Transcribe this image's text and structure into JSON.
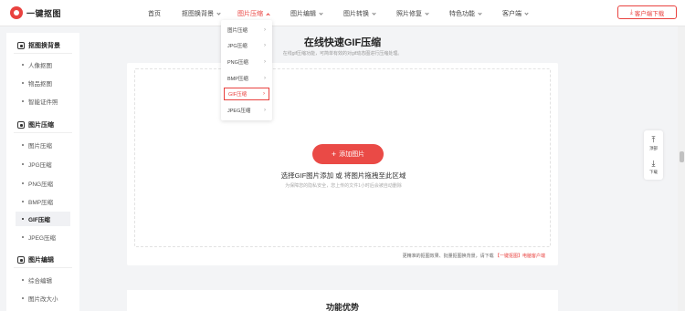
{
  "app": {
    "logo_text": "一键抠图"
  },
  "nav": {
    "items": [
      {
        "label": "首页"
      },
      {
        "label": "抠图换背景"
      },
      {
        "label": "图片压缩"
      },
      {
        "label": "图片编辑"
      },
      {
        "label": "图片转换"
      },
      {
        "label": "照片修复"
      },
      {
        "label": "特色功能"
      },
      {
        "label": "客户端"
      }
    ],
    "download_label": "客户端下载",
    "active_color": "#e9423f"
  },
  "dropdown": {
    "items": [
      {
        "label": "图片压缩"
      },
      {
        "label": "JPG压缩"
      },
      {
        "label": "PNG压缩"
      },
      {
        "label": "BMP压缩"
      },
      {
        "label": "GIF压缩"
      },
      {
        "label": "JPEG压缩"
      }
    ],
    "arrow": "›",
    "active_index": 4
  },
  "sidebar": {
    "sections": [
      {
        "title": "抠图换背景",
        "items": [
          "人像抠图",
          "物品抠图",
          "智能证件照"
        ]
      },
      {
        "title": "图片压缩",
        "items": [
          "图片压缩",
          "JPG压缩",
          "PNG压缩",
          "BMP压缩",
          "GIF压缩",
          "JPEG压缩"
        ]
      },
      {
        "title": "图片编辑",
        "items": [
          "综合编辑",
          "图片改大小"
        ]
      }
    ],
    "active_item": "GIF压缩"
  },
  "main": {
    "title": "在线快速GIF压缩",
    "subtitle": "在线gif压缩功能，可简单有效的对gif动态图进行压缩处理。",
    "add_button": "添加图片",
    "drop_text": "选择GIF图片添加 或 将图片拖拽至此区域",
    "privacy_text": "为保障您的隐私安全，您上传的文件1小时后会被自动删除",
    "footer_hint_prefix": "更精准的抠图效果、批量抠图换背景，请下载",
    "footer_hint_link": "【一键抠图】电脑客户端",
    "features_title": "功能优势",
    "accent_color": "#ea4a46"
  },
  "float_panel": {
    "top_label": "顶部",
    "download_label": "下载"
  }
}
